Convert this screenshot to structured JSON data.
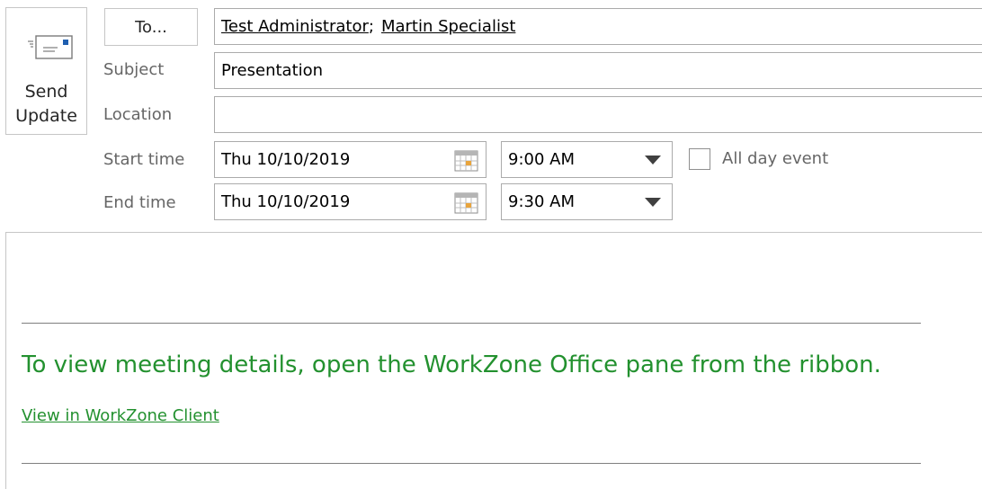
{
  "toolbar": {
    "send_label_line1": "Send",
    "send_label_line2": "Update",
    "send_icon": "envelope-icon"
  },
  "recipients": {
    "to_button": "To...",
    "items": [
      "Test Administrator",
      "Martin Specialist"
    ],
    "separator": ";"
  },
  "subject": {
    "label": "Subject",
    "value": "Presentation"
  },
  "location": {
    "label": "Location",
    "value": ""
  },
  "start": {
    "label": "Start time",
    "date": "Thu 10/10/2019",
    "time": "9:00 AM"
  },
  "end": {
    "label": "End time",
    "date": "Thu 10/10/2019",
    "time": "9:30 AM"
  },
  "all_day": {
    "label": "All day event",
    "checked": false
  },
  "body": {
    "message": "To view meeting details, open the WorkZone Office pane from the ribbon.",
    "link": "View in WorkZone Client"
  },
  "colors": {
    "accent_green": "#23912f",
    "label_gray": "#666666",
    "border": "#ababab"
  }
}
